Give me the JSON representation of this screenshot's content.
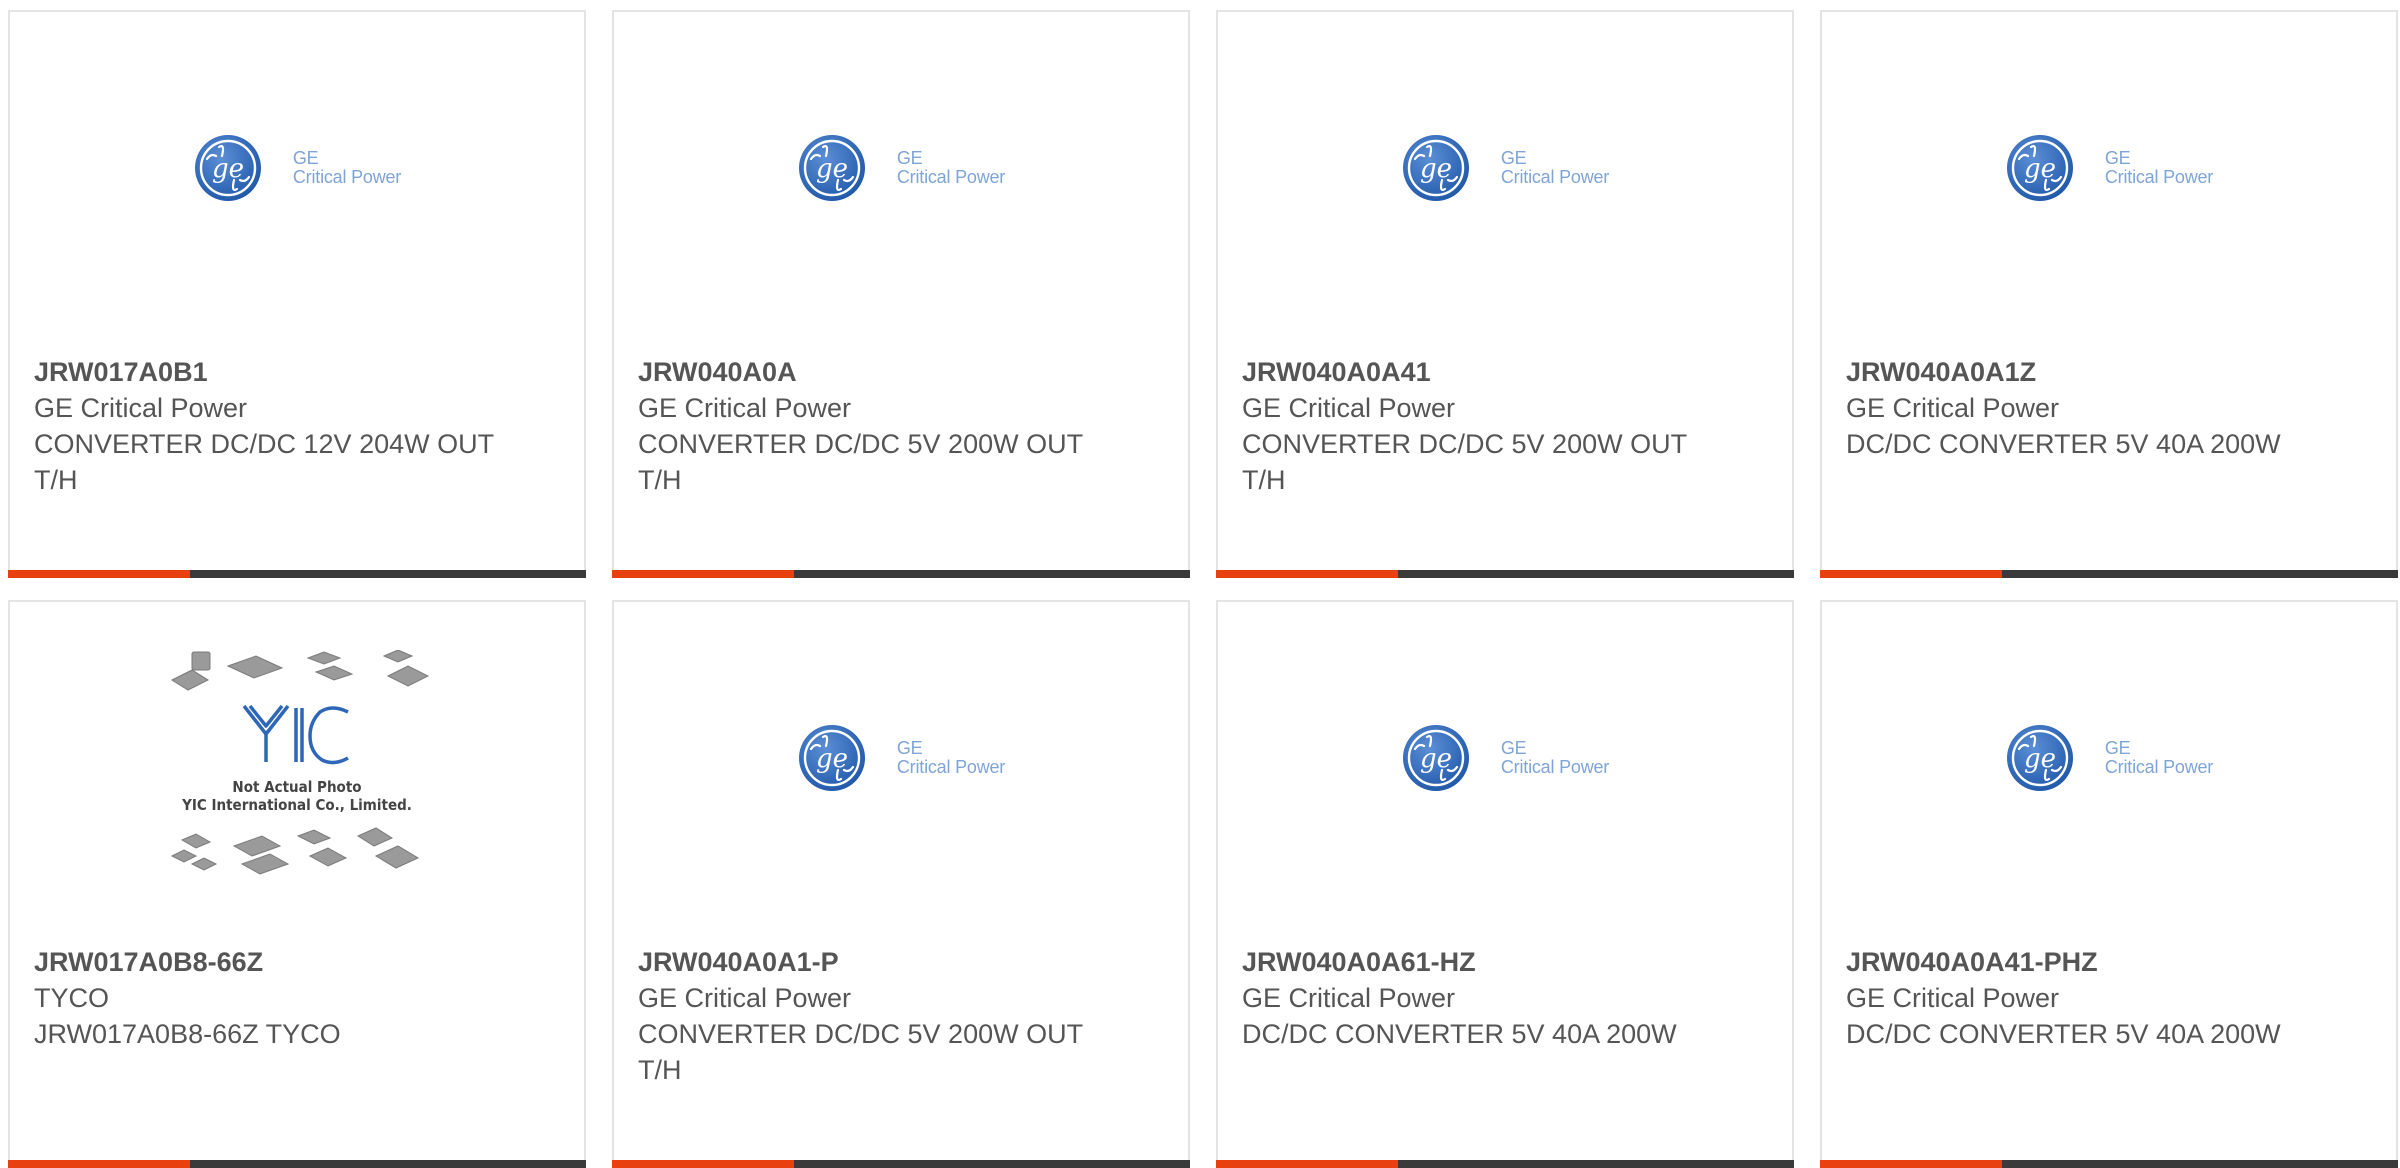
{
  "logos": {
    "ge_line1": "GE",
    "ge_line2": "Critical Power",
    "placeholder_line1": "Not Actual Photo",
    "placeholder_line2": "YIC International Co., Limited."
  },
  "colors": {
    "accent": "#e8400e",
    "bar_dark": "#3a3a3a",
    "ge_blue": "#2e67b8",
    "text": "#555555"
  },
  "products": [
    {
      "part": "JRW017A0B1",
      "manufacturer": "GE Critical Power",
      "description": "CONVERTER DC/DC 12V 204W OUT T/H",
      "image": "ge-critical-power-logo"
    },
    {
      "part": "JRW040A0A",
      "manufacturer": "GE Critical Power",
      "description": "CONVERTER DC/DC 5V 200W OUT T/H",
      "image": "ge-critical-power-logo"
    },
    {
      "part": "JRW040A0A41",
      "manufacturer": "GE Critical Power",
      "description": "CONVERTER DC/DC 5V 200W OUT T/H",
      "image": "ge-critical-power-logo"
    },
    {
      "part": "JRW040A0A1Z",
      "manufacturer": "GE Critical Power",
      "description": "DC/DC CONVERTER 5V 40A 200W",
      "image": "ge-critical-power-logo"
    },
    {
      "part": "JRW017A0B8-66Z",
      "manufacturer": "TYCO",
      "description": "JRW017A0B8-66Z TYCO",
      "image": "not-actual-photo-placeholder"
    },
    {
      "part": "JRW040A0A1-P",
      "manufacturer": "GE Critical Power",
      "description": "CONVERTER DC/DC 5V 200W OUT T/H",
      "image": "ge-critical-power-logo"
    },
    {
      "part": "JRW040A0A61-HZ",
      "manufacturer": "GE Critical Power",
      "description": "DC/DC CONVERTER 5V 40A 200W",
      "image": "ge-critical-power-logo"
    },
    {
      "part": "JRW040A0A41-PHZ",
      "manufacturer": "GE Critical Power",
      "description": "DC/DC CONVERTER 5V 40A 200W",
      "image": "ge-critical-power-logo"
    }
  ]
}
